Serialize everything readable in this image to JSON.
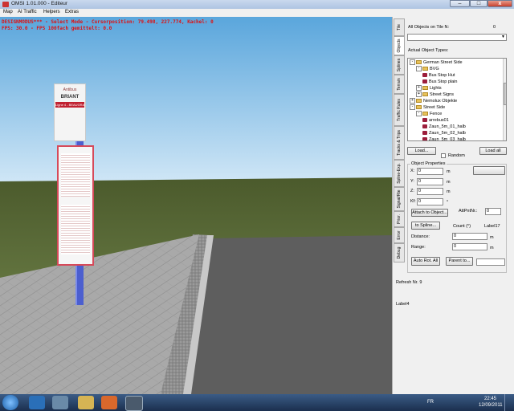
{
  "window": {
    "title": "OMSI 1.01.000 - Editeur",
    "min_symbol": "–",
    "max_symbol": "□",
    "close_symbol": "x"
  },
  "menu": [
    "Map",
    "AI Traffic",
    "Helpers",
    "Extras"
  ],
  "viewport": {
    "status_line1": "DESIGNMODUS*** - Select Mode - Cursorposition: 79.498, 227.774, Kachel: 0",
    "status_line2": "FPS: 30.0 - FPS 100fach gemittelt: 0.0",
    "sign": {
      "brand": "Antibus",
      "stop_name": "BRIANT",
      "line": "Ligne 4 - BEAUGRAINS"
    }
  },
  "tabs": [
    "Tile",
    "Objects",
    "Splines",
    "Terrain",
    "Traffic Rules",
    "Tracks & Trips",
    "Spline-Exp.",
    "Signal/Rte",
    "Prior.",
    "Error",
    "Debug"
  ],
  "objects_panel": {
    "all_objects_label": "All Objects on Tile N:",
    "all_objects_count": "0",
    "dropdown_value": "",
    "actual_types_label": "Actual Object Types:",
    "tree": [
      {
        "label": "German Street Side",
        "level": 0,
        "type": "folder",
        "expander": "-"
      },
      {
        "label": "BVG",
        "level": 1,
        "type": "folder",
        "expander": "-"
      },
      {
        "label": "Bus Stop Hut",
        "level": 2,
        "type": "object",
        "expander": ""
      },
      {
        "label": "Bus Stop plain",
        "level": 2,
        "type": "object",
        "expander": ""
      },
      {
        "label": "Lights",
        "level": 1,
        "type": "folder",
        "expander": "+"
      },
      {
        "label": "Street Signs",
        "level": 1,
        "type": "folder",
        "expander": "+"
      },
      {
        "label": "Nemolux Objekte",
        "level": 0,
        "type": "folder",
        "expander": "+"
      },
      {
        "label": "Street Side",
        "level": 0,
        "type": "folder",
        "expander": "-"
      },
      {
        "label": "Fence",
        "level": 1,
        "type": "folder",
        "expander": "-"
      },
      {
        "label": "arrebus01",
        "level": 2,
        "type": "object",
        "expander": ""
      },
      {
        "label": "Zaun_5m_01_halb",
        "level": 2,
        "type": "object",
        "expander": ""
      },
      {
        "label": "Zaun_5m_02_halb",
        "level": 2,
        "type": "object",
        "expander": ""
      },
      {
        "label": "Zaun_5m_03_halb",
        "level": 2,
        "type": "object",
        "expander": ""
      }
    ],
    "load_button": "Load...",
    "random_label": "Random",
    "load_all_button": "Load all",
    "properties_label": "Object Properties",
    "coords": [
      {
        "label": "X:",
        "value": "0",
        "unit": "m"
      },
      {
        "label": "Y:",
        "value": "0",
        "unit": "m"
      },
      {
        "label": "Z:",
        "value": "0",
        "unit": "m"
      },
      {
        "label": "Kf:",
        "value": "0",
        "unit": "°"
      }
    ],
    "attach_object_button": "Attach to Object...",
    "att_label": "AttPntNr.:",
    "att_value": "0",
    "to_spline_button": "to Spline...",
    "count_label": "Count (°)",
    "label17": "Label17",
    "distance_label": "Distance:",
    "distance_value": "0",
    "distance_unit": "m",
    "range_label": "Range:",
    "range_value": "0",
    "range_unit": "m",
    "auto_rot_button": "Auto Rot. All",
    "parent_button": "Parent to...",
    "refresh_text": "Refresh Nr. 9",
    "label4": "Label4"
  },
  "taskbar": {
    "language": "FR",
    "time": "22:45",
    "date": "12/09/2011"
  }
}
